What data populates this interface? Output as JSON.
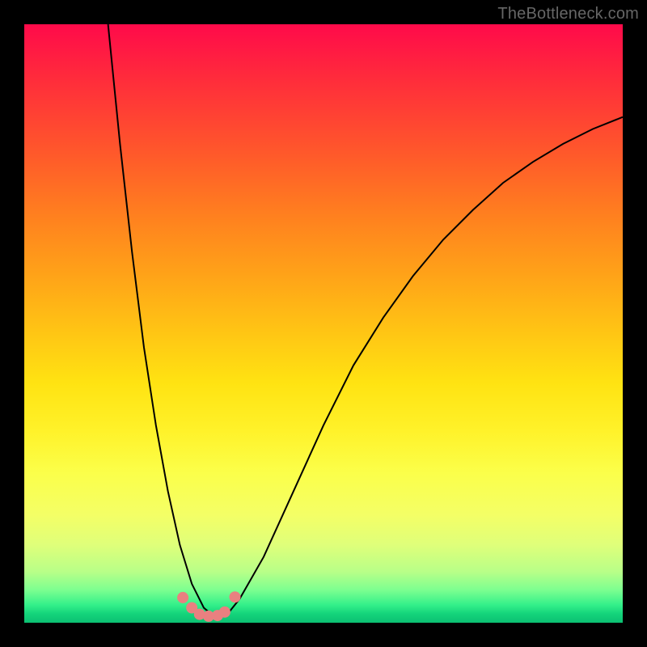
{
  "watermark": "TheBottleneck.com",
  "colors": {
    "marker": "#e98080",
    "curve": "#000000",
    "frame": "#000000"
  },
  "chart_data": {
    "type": "line",
    "title": "",
    "xlabel": "",
    "ylabel": "",
    "xlim": [
      0,
      100
    ],
    "ylim": [
      0,
      100
    ],
    "series": [
      {
        "name": "curve-main",
        "x": [
          14,
          16,
          18,
          20,
          22,
          24,
          26,
          28,
          30,
          32,
          34,
          36,
          40,
          45,
          50,
          55,
          60,
          65,
          70,
          75,
          80,
          85,
          90,
          95,
          100
        ],
        "y": [
          100,
          80,
          62,
          46,
          33,
          22,
          13,
          6.5,
          2.5,
          0.8,
          1.5,
          4,
          11,
          22,
          33,
          43,
          51,
          58,
          64,
          69,
          73.5,
          77,
          80,
          82.5,
          84.5
        ]
      }
    ],
    "scatter": {
      "name": "bottom-markers",
      "x": [
        26.5,
        28,
        29.3,
        30.8,
        32.3,
        33.5,
        35.2
      ],
      "y": [
        4.2,
        2.5,
        1.4,
        1.1,
        1.2,
        1.8,
        4.3
      ]
    },
    "background_gradient": {
      "top": "#ff0a4a",
      "mid": "#ffe312",
      "bottom": "#0cc072"
    }
  }
}
